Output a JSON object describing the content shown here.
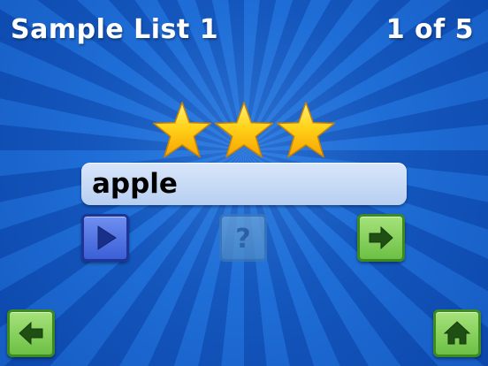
{
  "header": {
    "list_title": "Sample List 1",
    "progress_text": "1 of 5"
  },
  "stars": {
    "earned": 3,
    "total": 3
  },
  "word": {
    "text": "apple"
  },
  "buttons": {
    "play": {
      "icon": "play-icon",
      "enabled": true
    },
    "help": {
      "icon": "question-mark-icon",
      "enabled": false
    },
    "next": {
      "icon": "arrow-right-icon",
      "enabled": true
    },
    "back": {
      "icon": "arrow-left-icon",
      "enabled": true
    },
    "home": {
      "icon": "home-icon",
      "enabled": true
    }
  },
  "colors": {
    "background_light": "#1d6ed6",
    "background_dark": "#1153b8",
    "star_fill": "#ffc400",
    "play_button": "#4a6fe0",
    "nav_button": "#7cc94f"
  }
}
